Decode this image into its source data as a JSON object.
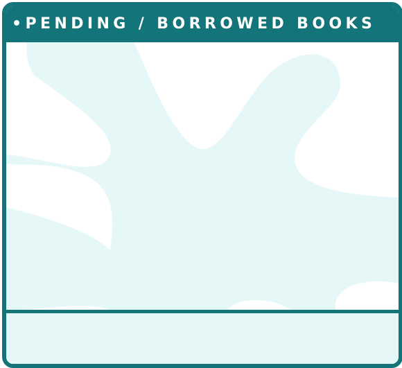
{
  "header": {
    "title": "•PENDING / BORROWED BOOKS"
  },
  "colors": {
    "frame": "#137479",
    "blob": "#e6f7f8",
    "background": "#ffffff",
    "title_text": "#ffffff"
  },
  "content": {
    "items": []
  }
}
